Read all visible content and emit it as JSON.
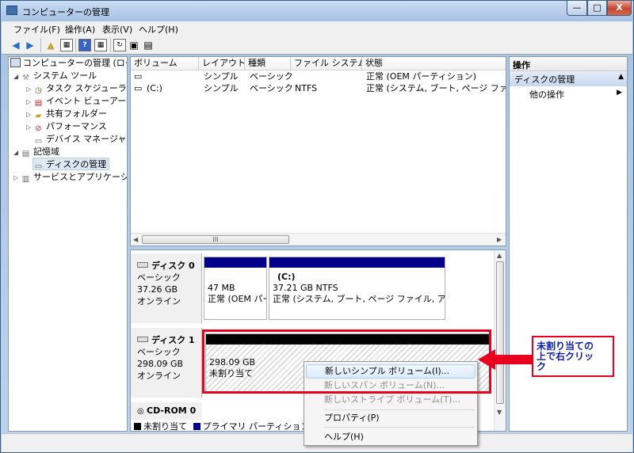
{
  "window": {
    "title": "コンピューターの管理",
    "controls": {
      "minimize": "—",
      "maximize": "□",
      "close": "X"
    }
  },
  "menu": [
    "ファイル(F)",
    "操作(A)",
    "表示(V)",
    "ヘルプ(H)"
  ],
  "toolbar": {
    "help_glyph": "?"
  },
  "tree": {
    "root": "コンピューターの管理 (ローカ",
    "system_tools": "システム ツール",
    "task_scheduler": "タスク スケジューラ",
    "event_viewer": "イベント ビューアー",
    "shared_folders": "共有フォルダー",
    "performance": "パフォーマンス",
    "device_manager": "デバイス マネージャー",
    "storage": "記憶域",
    "disk_management": "ディスクの管理",
    "services": "サービスとアプリケーショ"
  },
  "volume_table": {
    "headers": [
      "ボリューム",
      "レイアウト",
      "種類",
      "ファイル システム",
      "状態"
    ],
    "rows": [
      {
        "volume": "",
        "layout": "シンプル",
        "type": "ベーシック",
        "fs": "",
        "status": "正常 (OEM パーティション)"
      },
      {
        "volume": "(C:)",
        "layout": "シンプル",
        "type": "ベーシック",
        "fs": "NTFS",
        "status": "正常 (システム, ブート, ページ ファイル"
      }
    ],
    "scroll_thumb": "III"
  },
  "disks": {
    "disk0": {
      "name": "ディスク 0",
      "kind": "ベーシック",
      "size": "37.26 GB",
      "state": "オンライン",
      "p1": {
        "size": "47 MB",
        "status": "正常 (OEM パー"
      },
      "p2": {
        "label": "(C:)",
        "size": "37.21 GB NTFS",
        "status": "正常 (システム, ブート, ページ ファイル, アクテ"
      }
    },
    "disk1": {
      "name": "ディスク 1",
      "kind": "ベーシック",
      "size": "298.09 GB",
      "state": "オンライン",
      "p1": {
        "size": "298.09 GB",
        "status": "未割り当て"
      }
    },
    "cdrom": {
      "name": "CD-ROM 0"
    }
  },
  "legend": {
    "unallocated": "未割り当て",
    "primary": "プライマリ パーティション"
  },
  "actions": {
    "header": "操作",
    "section": "ディスクの管理",
    "more": "他の操作"
  },
  "context_menu": {
    "items": [
      {
        "label": "新しいシンプル ボリューム(I)...",
        "state": "highlighted"
      },
      {
        "label": "新しいスパン ボリューム(N)...",
        "state": "disabled"
      },
      {
        "label": "新しいストライプ ボリューム(T)...",
        "state": "disabled"
      },
      {
        "label": "プロパティ(P)",
        "state": "normal"
      },
      {
        "label": "ヘルプ(H)",
        "state": "normal"
      }
    ]
  },
  "annotation": {
    "line1": "未割り当ての",
    "line2": "上で右クリッ",
    "line3": "ク"
  },
  "colors": {
    "primary_partition": "#00008b",
    "unallocated": "#000000",
    "annotation_red": "#e8001e",
    "annotation_text": "#0d1db0"
  }
}
